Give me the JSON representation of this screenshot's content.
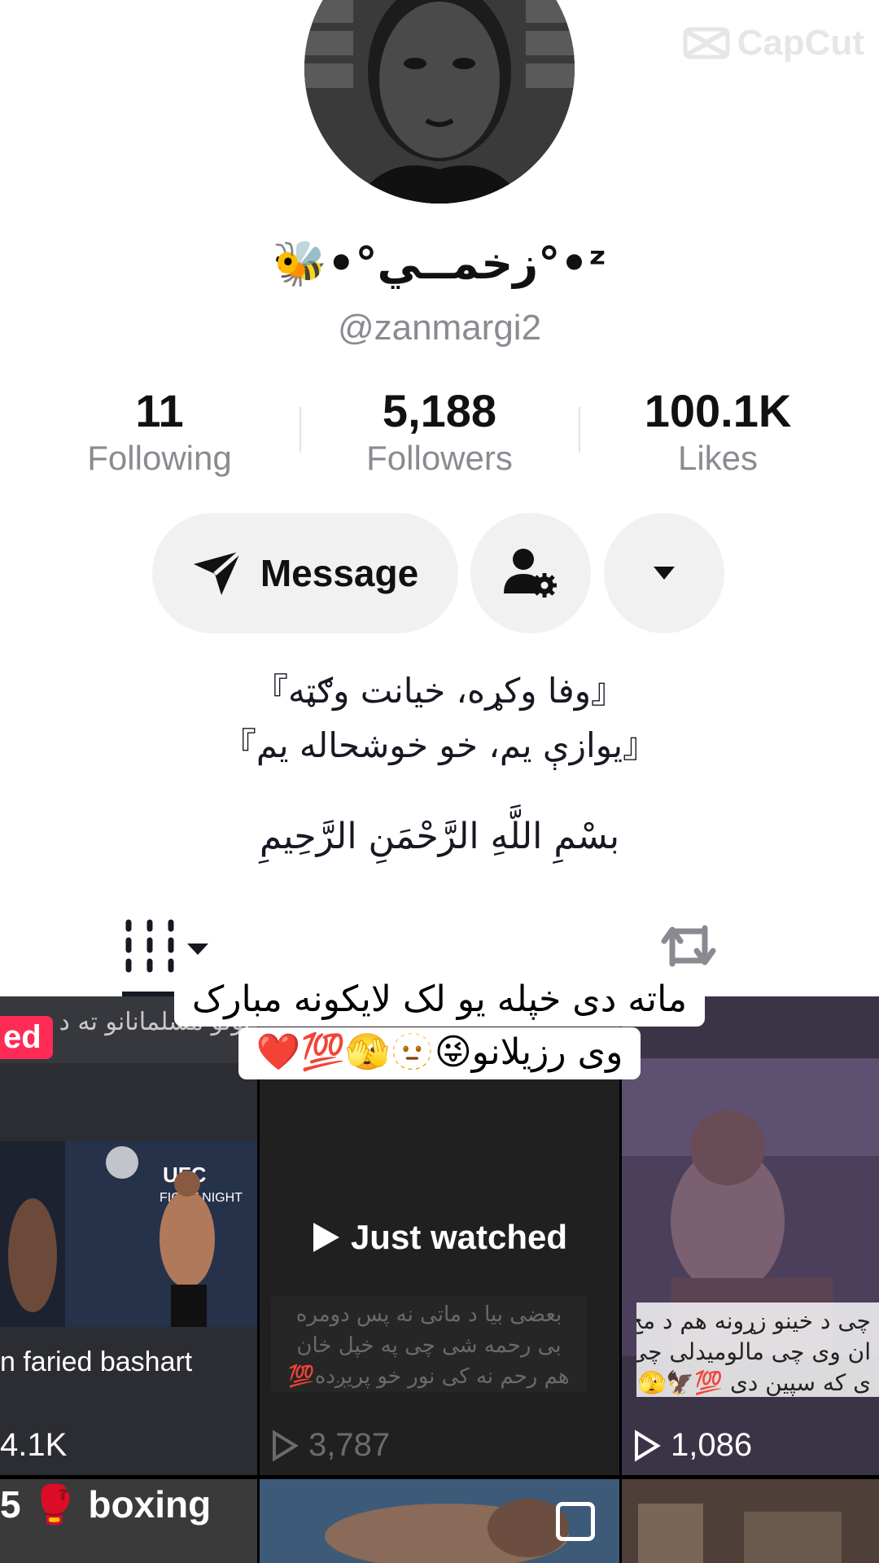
{
  "watermark": {
    "text": "CapCut"
  },
  "profile": {
    "display_name": "ᶻ•°زخمــي°•🐝",
    "username": "@zanmargi2"
  },
  "stats": [
    {
      "value": "11",
      "label": "Following"
    },
    {
      "value": "5,188",
      "label": "Followers"
    },
    {
      "value": "100.1K",
      "label": "Likes"
    }
  ],
  "actions": {
    "message_label": "Message",
    "friends_icon": "add-friend-settings-icon",
    "more_icon": "caret-down-icon"
  },
  "bio": {
    "line1": "『وفا وکړه، خیانت وګټه』",
    "line2": "『یوازې یم، خو خوشحاله یم』",
    "line3": "بسْمِ اللَّهِ الرَّحْمَنِ الرَّحِيمِ"
  },
  "tabs": {
    "grid_icon": "grid-icon",
    "repost_icon": "repost-icon"
  },
  "caption": {
    "line1": "ماته دی خپله یو لک لایکونه مبارک",
    "line2": "وی رزیلانو😜🫥🫣💯❤️"
  },
  "videos": [
    {
      "badge": "ed",
      "overlay_text": "بولو مسلمانانو ته د",
      "title": "n faried bashart",
      "views": "4.1K"
    },
    {
      "label": "Just watched",
      "overlay_lines": [
        "بعضی بیا د ماتی نه پس دومره",
        "بی رحمه شی چی په خپل خان",
        "هم رحم نه کی نور خو پریږده💯"
      ],
      "views": "3,787"
    },
    {
      "overlay_lines": [
        "چی د خینو زړونه هم د مخ",
        "ان وی چی مالومیدلی چی",
        "ی که سپین دی 💯🦅🫣"
      ],
      "views": "1,086"
    },
    {
      "title": "5 🥊 boxing"
    },
    {},
    {}
  ]
}
